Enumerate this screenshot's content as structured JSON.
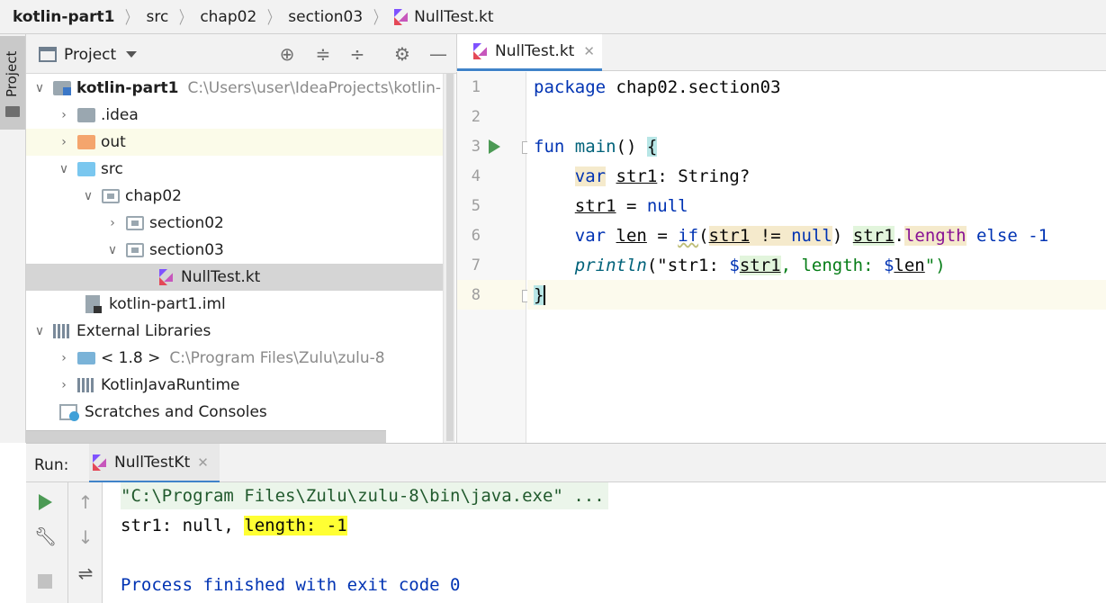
{
  "breadcrumb": [
    "kotlin-part1",
    "src",
    "chap02",
    "section03",
    "NullTest.kt"
  ],
  "stripe": {
    "project_label": "Project"
  },
  "project_panel": {
    "title": "Project",
    "toolbar_icons": [
      "locate-icon",
      "expand-all-icon",
      "collapse-all-icon",
      "gear-icon",
      "minimize-icon"
    ],
    "tree": [
      {
        "label": "kotlin-part1",
        "path": "C:\\Users\\user\\IdeaProjects\\kotlin-",
        "arrow": "v",
        "indent": 0,
        "icon": "module-folder-icon"
      },
      {
        "label": ".idea",
        "arrow": ">",
        "indent": 1,
        "icon": "folder-icon"
      },
      {
        "label": "out",
        "arrow": ">",
        "indent": 1,
        "icon": "excluded-folder-icon"
      },
      {
        "label": "src",
        "arrow": "v",
        "indent": 1,
        "icon": "source-folder-icon"
      },
      {
        "label": "chap02",
        "arrow": "v",
        "indent": 2,
        "icon": "package-icon"
      },
      {
        "label": "section02",
        "arrow": ">",
        "indent": 3,
        "icon": "package-icon"
      },
      {
        "label": "section03",
        "arrow": "v",
        "indent": 3,
        "icon": "package-icon"
      },
      {
        "label": "NullTest.kt",
        "arrow": "",
        "indent": 5,
        "icon": "kotlin-file-icon"
      },
      {
        "label": "kotlin-part1.iml",
        "arrow": "",
        "indent": 1,
        "icon": "iml-file-icon"
      },
      {
        "label": "External Libraries",
        "arrow": "v",
        "indent": 0,
        "icon": "libraries-icon"
      },
      {
        "label": "< 1.8 >",
        "path": "C:\\Program Files\\Zulu\\zulu-8",
        "arrow": ">",
        "indent": 1,
        "icon": "jdk-icon"
      },
      {
        "label": "KotlinJavaRuntime",
        "arrow": ">",
        "indent": 1,
        "icon": "library-icon"
      },
      {
        "label": "Scratches and Consoles",
        "arrow": "",
        "indent": 0,
        "icon": "scratches-icon"
      }
    ]
  },
  "editor": {
    "tab_label": "NullTest.kt",
    "line_numbers": [
      "1",
      "2",
      "3",
      "4",
      "5",
      "6",
      "7",
      "8"
    ],
    "code": {
      "l1_kw": "package",
      "l1_rest": " chap02.section03",
      "l3_kw": "fun",
      "l3_fn": "main",
      "l3_paren": "() ",
      "l3_brace": "{",
      "l4_kw": "var",
      "l4_name": "str1",
      "l4_rest": ": String?",
      "l5_name": "str1",
      "l5_eq": " = ",
      "l5_null": "null",
      "l6_kw": "var",
      "l6_name": "len",
      "l6_eq": " = ",
      "l6_if": "if",
      "l6_open": "(",
      "l6_cond": "str1",
      "l6_op": " != ",
      "l6_null": "null",
      "l6_close": ")",
      "l6_sp": " ",
      "l6_recv": "str1",
      "l6_dot": ".",
      "l6_prop": "length",
      "l6_else": " else",
      "l6_num": " -1",
      "l7_fn": "println",
      "l7_a": "(\"str1: ",
      "l7_d1": "$",
      "l7_v1": "str1",
      "l7_b": ", length: ",
      "l7_d2": "$",
      "l7_v2": "len",
      "l7_c": "\")",
      "l8_brace": "}"
    }
  },
  "run_panel": {
    "label": "Run:",
    "tab_label": "NullTestKt",
    "console": {
      "command": "\"C:\\Program Files\\Zulu\\zulu-8\\bin\\java.exe\" ...",
      "output_prefix": "str1: null, ",
      "output_highlight": "length: -1",
      "exit": "Process finished with exit code 0"
    }
  }
}
